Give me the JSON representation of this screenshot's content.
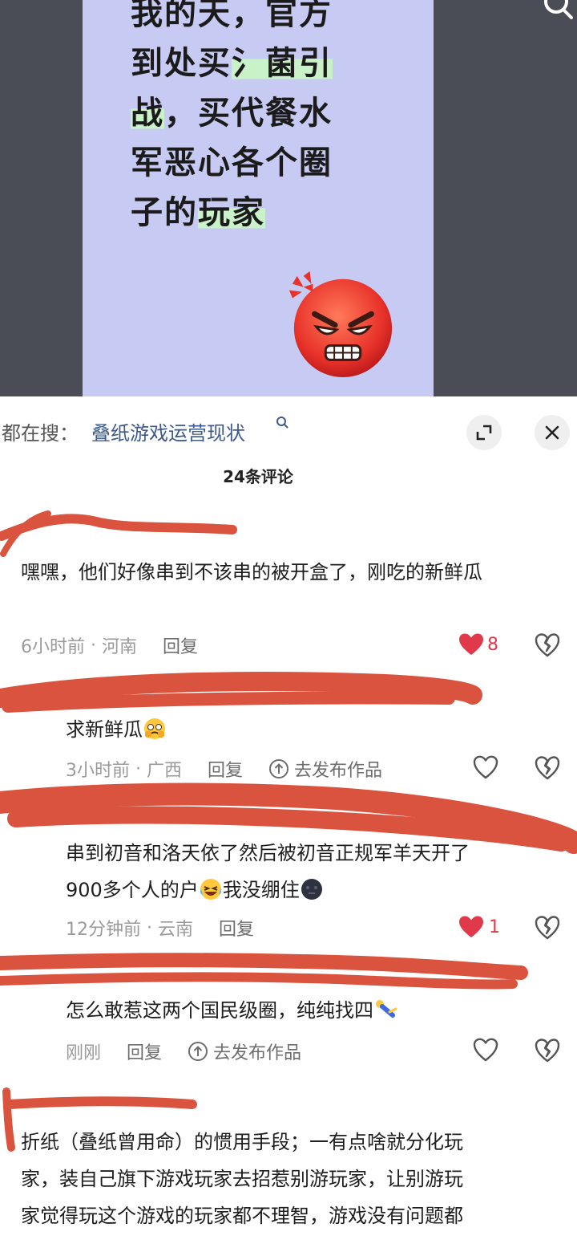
{
  "post": {
    "lines": [
      "我的天，官方",
      "到处买",
      "菌引",
      "战",
      "，买代餐水",
      "军恶心各个圈",
      "子的",
      "玩家"
    ]
  },
  "search": {
    "prefix": "都在搜：",
    "query": "叠纸游戏运营现状"
  },
  "comments_header": {
    "count_label": "24条评论"
  },
  "comments": [
    {
      "text": "嘿嘿，他们好像串到不该串的被开盒了，刚吃的新鲜瓜",
      "time": "6小时前",
      "location": "河南",
      "reply": "回复",
      "likes": "8"
    },
    {
      "text": "求新鲜瓜",
      "time": "3小时前",
      "location": "广西",
      "reply": "回复",
      "publish": "去发布作品"
    },
    {
      "text_line1": "串到初音和洛天依了然后被初音正规军羊天开了",
      "text_line2a": "900多个人的户",
      "text_line2b": "我没绷住",
      "time": "12分钟前",
      "location": "云南",
      "reply": "回复",
      "likes": "1"
    },
    {
      "text": "怎么敢惹这两个国民级圈，纯纯找四",
      "time": "刚刚",
      "reply": "回复",
      "publish": "去发布作品"
    },
    {
      "text_line1": "折纸（叠纸曾用命）的惯用手段；一有点啥就分化玩",
      "text_line2": "家，装自己旗下游戏玩家去招惹别游玩家，让别游玩",
      "text_line3": "家觉得玩这个游戏的玩家都不理智，游戏没有问题都"
    }
  ],
  "colors": {
    "accent_link": "#3d5a8a",
    "like_red": "#e03a4a",
    "scribble": "#d9533e",
    "card_bg": "#c7cbf3"
  },
  "icons": [
    "search-icon",
    "expand-icon",
    "close-icon",
    "heart-icon",
    "broken-heart-icon",
    "publish-icon",
    "angry-emoji-icon"
  ]
}
